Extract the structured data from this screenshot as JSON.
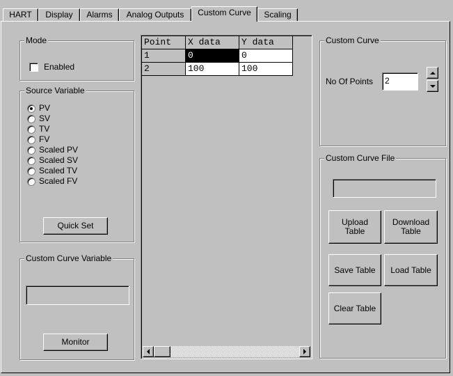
{
  "tabs": [
    {
      "label": "HART"
    },
    {
      "label": "Display"
    },
    {
      "label": "Alarms"
    },
    {
      "label": "Analog Outputs"
    },
    {
      "label": "Custom Curve"
    },
    {
      "label": "Scaling"
    }
  ],
  "active_tab": "Custom Curve",
  "mode": {
    "title": "Mode",
    "enabled_label": "Enabled",
    "enabled_checked": false
  },
  "source_variable": {
    "title": "Source Variable",
    "options": [
      "PV",
      "SV",
      "TV",
      "FV",
      "Scaled PV",
      "Scaled SV",
      "Scaled TV",
      "Scaled FV"
    ],
    "selected": "PV",
    "quick_set_label": "Quick Set"
  },
  "custom_curve_variable": {
    "title": "Custom Curve Variable",
    "value": "",
    "monitor_label": "Monitor"
  },
  "table": {
    "headers": [
      "Point",
      "X data",
      "Y data"
    ],
    "rows": [
      [
        "1",
        "0",
        "0"
      ],
      [
        "2",
        "100",
        "100"
      ]
    ],
    "selected_cell": "1:X data"
  },
  "custom_curve": {
    "title": "Custom Curve",
    "no_of_points_label": "No Of Points",
    "no_of_points_value": "2"
  },
  "custom_curve_file": {
    "title": "Custom Curve File",
    "file_value": "",
    "upload_label": "Upload\nTable",
    "download_label": "Download\nTable",
    "save_label": "Save Table",
    "load_label": "Load Table",
    "clear_label": "Clear Table"
  }
}
